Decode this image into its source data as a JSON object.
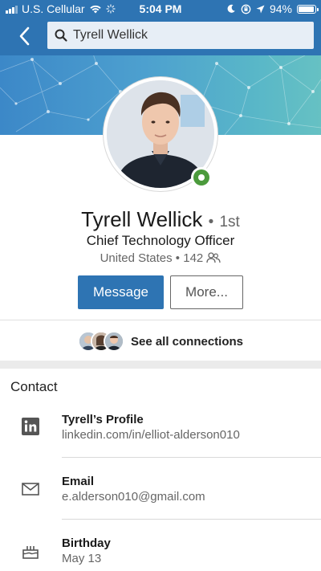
{
  "status_bar": {
    "carrier": "U.S. Cellular",
    "time": "5:04 PM",
    "battery": "94%",
    "battery_level": 0.94
  },
  "nav": {
    "search_value": "Tyrell Wellick"
  },
  "profile": {
    "name": "Tyrell Wellick",
    "degree_separator": "•",
    "degree": "1st",
    "headline": "Chief Technology Officer",
    "location": "United States",
    "meta_separator": "•",
    "connections_count": "142",
    "online": true
  },
  "actions": {
    "message_label": "Message",
    "more_label": "More..."
  },
  "connections": {
    "label": "See all connections"
  },
  "contact": {
    "heading": "Contact",
    "items": [
      {
        "icon": "linkedin-icon",
        "label": "Tyrell’s Profile",
        "value": "linkedin.com/in/elliot-alderson010"
      },
      {
        "icon": "envelope-icon",
        "label": "Email",
        "value": "e.alderson010@gmail.com"
      },
      {
        "icon": "birthday-cake-icon",
        "label": "Birthday",
        "value": "May 13"
      }
    ]
  },
  "colors": {
    "brand_blue": "#2e74b3",
    "online_green": "#4b9a3c"
  }
}
